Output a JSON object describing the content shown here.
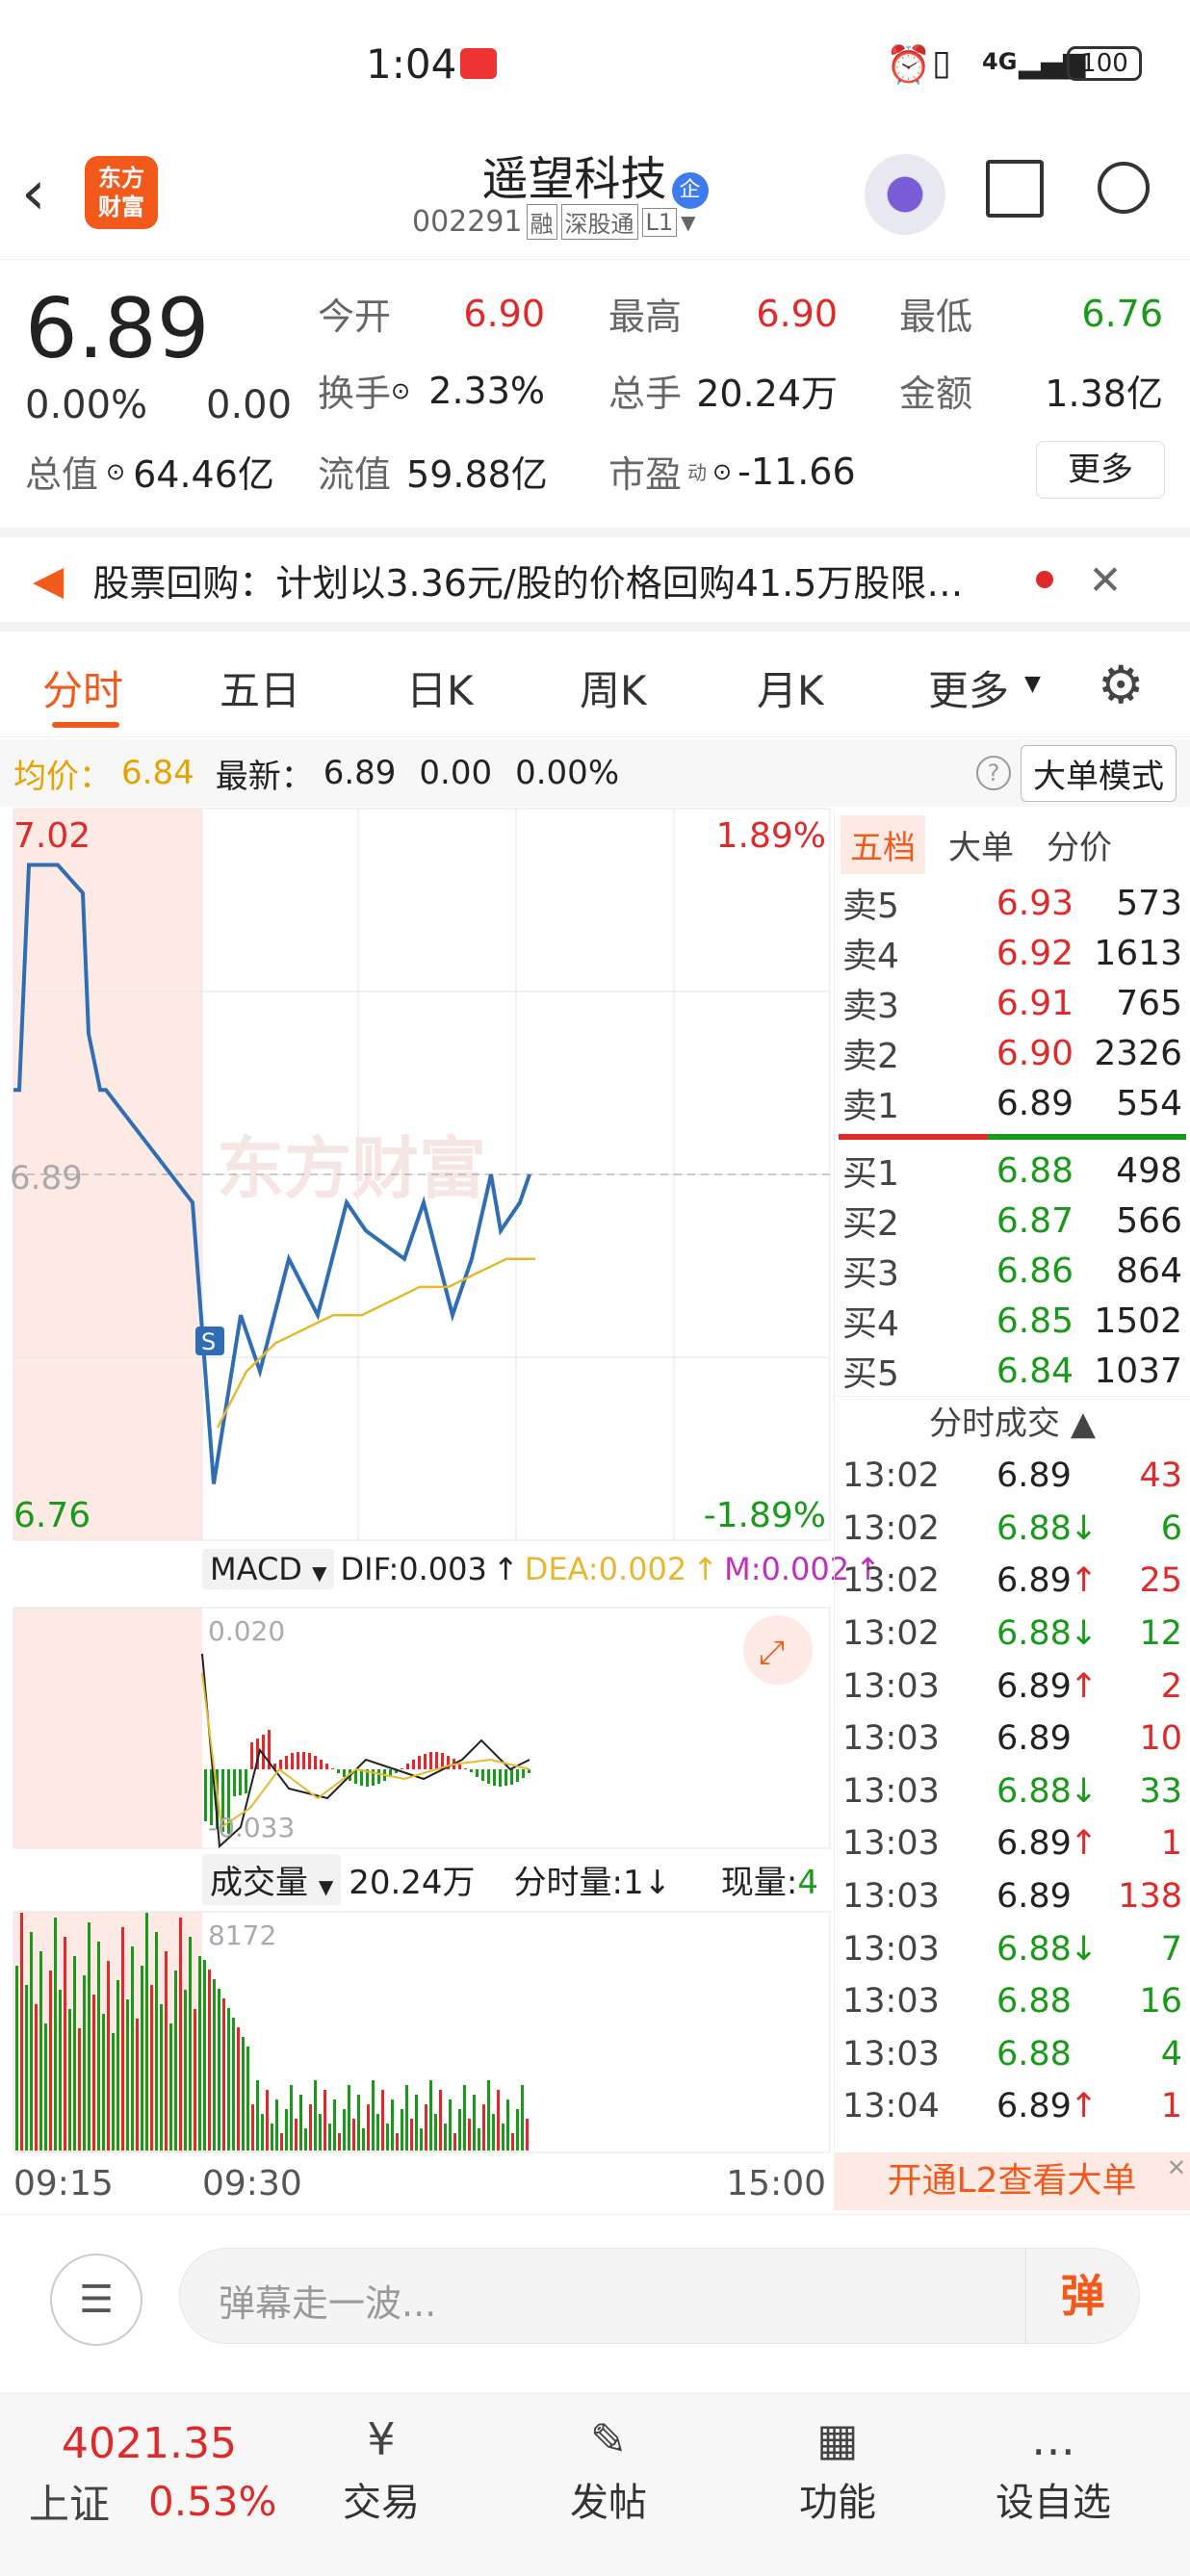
{
  "status": {
    "time": "1:04",
    "net": "4G",
    "battery": "100"
  },
  "header": {
    "title": "遥望科技",
    "badge": "企",
    "code": "002291",
    "tags": [
      "融",
      "深股通",
      "L1"
    ],
    "logo_line1": "东方",
    "logo_line2": "财富"
  },
  "quote": {
    "price": "6.89",
    "pct": "0.00%",
    "chg": "0.00",
    "rows": [
      [
        {
          "k": "今开",
          "v": "6.90",
          "c": "red"
        },
        {
          "k": "最高",
          "v": "6.90",
          "c": "red"
        },
        {
          "k": "最低",
          "v": "6.76",
          "c": "green"
        }
      ],
      [
        {
          "k": "换手",
          "v": "2.33%",
          "c": "dark"
        },
        {
          "k": "总手",
          "v": "20.24万",
          "c": "dark"
        },
        {
          "k": "金额",
          "v": "1.38亿",
          "c": "dark"
        }
      ]
    ],
    "total_label": "总值",
    "total": "64.46亿",
    "float_label": "流值",
    "float": "59.88亿",
    "pe_label": "市盈",
    "pe_sup": "动",
    "pe": "-11.66",
    "more": "更多"
  },
  "notice": {
    "text": "股票回购：计划以3.36元/股的价格回购41.5万股限…"
  },
  "tabs": [
    "分时",
    "五日",
    "日K",
    "周K",
    "月K",
    "更多"
  ],
  "infobar": {
    "avg_label": "均价：",
    "avg": "6.84",
    "latest_label": "最新：",
    "latest": "6.89",
    "chg": "0.00",
    "pct": "0.00%",
    "mode": "大单模式"
  },
  "chart": {
    "hi": "7.02",
    "lo": "6.76",
    "hi_pct": "1.89%",
    "lo_pct": "-1.89%",
    "mid": "6.89",
    "watermark": "东方财富",
    "t_open": "09:15",
    "t_mid": "09:30",
    "t_end": "15:00",
    "marker": "S"
  },
  "chart_data": {
    "type": "line",
    "ylim": [
      6.76,
      7.02
    ],
    "x": [
      "09:15",
      "09:30",
      "15:00"
    ],
    "series": [
      {
        "name": "price",
        "values": [
          6.92,
          6.92,
          7.0,
          7.0,
          6.99,
          6.94,
          6.92,
          6.92,
          6.88,
          6.78,
          6.84,
          6.82,
          6.86,
          6.84,
          6.88,
          6.87,
          6.86,
          6.88,
          6.84,
          6.86,
          6.89,
          6.87,
          6.88,
          6.89
        ]
      },
      {
        "name": "avg",
        "values": [
          6.8,
          6.82,
          6.83,
          6.835,
          6.84,
          6.84,
          6.845,
          6.85,
          6.85,
          6.855,
          6.86,
          6.86
        ]
      }
    ]
  },
  "macd": {
    "label": "MACD",
    "dif": "DIF:0.003",
    "dea": "DEA:0.002",
    "m": "M:0.002",
    "top": "0.020",
    "bot": "-0.033"
  },
  "volume": {
    "label": "成交量",
    "total": "20.24万",
    "period": "分时量:1",
    "now_label": "现量:",
    "now": "4",
    "peak": "8172"
  },
  "book": {
    "tabs": [
      "五档",
      "大单",
      "分价"
    ],
    "asks": [
      {
        "l": "卖5",
        "p": "6.93",
        "v": "573"
      },
      {
        "l": "卖4",
        "p": "6.92",
        "v": "1613"
      },
      {
        "l": "卖3",
        "p": "6.91",
        "v": "765"
      },
      {
        "l": "卖2",
        "p": "6.90",
        "v": "2326"
      },
      {
        "l": "卖1",
        "p": "6.89",
        "v": "554"
      }
    ],
    "bids": [
      {
        "l": "买1",
        "p": "6.88",
        "v": "498"
      },
      {
        "l": "买2",
        "p": "6.87",
        "v": "566"
      },
      {
        "l": "买3",
        "p": "6.86",
        "v": "864"
      },
      {
        "l": "买4",
        "p": "6.85",
        "v": "1502"
      },
      {
        "l": "买5",
        "p": "6.84",
        "v": "1037"
      }
    ]
  },
  "ticks": {
    "title": "分时成交",
    "rows": [
      {
        "t": "13:02",
        "p": "6.89",
        "d": "",
        "v": "43"
      },
      {
        "t": "13:02",
        "p": "6.88",
        "d": "↓",
        "v": "6"
      },
      {
        "t": "13:02",
        "p": "6.89",
        "d": "↑",
        "v": "25"
      },
      {
        "t": "13:02",
        "p": "6.88",
        "d": "↓",
        "v": "12"
      },
      {
        "t": "13:03",
        "p": "6.89",
        "d": "↑",
        "v": "2"
      },
      {
        "t": "13:03",
        "p": "6.89",
        "d": "",
        "v": "10"
      },
      {
        "t": "13:03",
        "p": "6.88",
        "d": "↓",
        "v": "33"
      },
      {
        "t": "13:03",
        "p": "6.89",
        "d": "↑",
        "v": "1"
      },
      {
        "t": "13:03",
        "p": "6.89",
        "d": "",
        "v": "138"
      },
      {
        "t": "13:03",
        "p": "6.88",
        "d": "↓",
        "v": "7"
      },
      {
        "t": "13:03",
        "p": "6.88",
        "d": "",
        "v": "16"
      },
      {
        "t": "13:03",
        "p": "6.88",
        "d": "",
        "v": "4"
      },
      {
        "t": "13:04",
        "p": "6.89",
        "d": "↑",
        "v": "1"
      }
    ]
  },
  "l2": "开通L2查看大单",
  "danmu": {
    "placeholder": "弹幕走一波...",
    "btn": "弹"
  },
  "bottom": {
    "index": "4021.35",
    "index_name": "上证",
    "index_pct": "0.53%",
    "items": [
      "交易",
      "发帖",
      "功能",
      "设自选"
    ]
  }
}
